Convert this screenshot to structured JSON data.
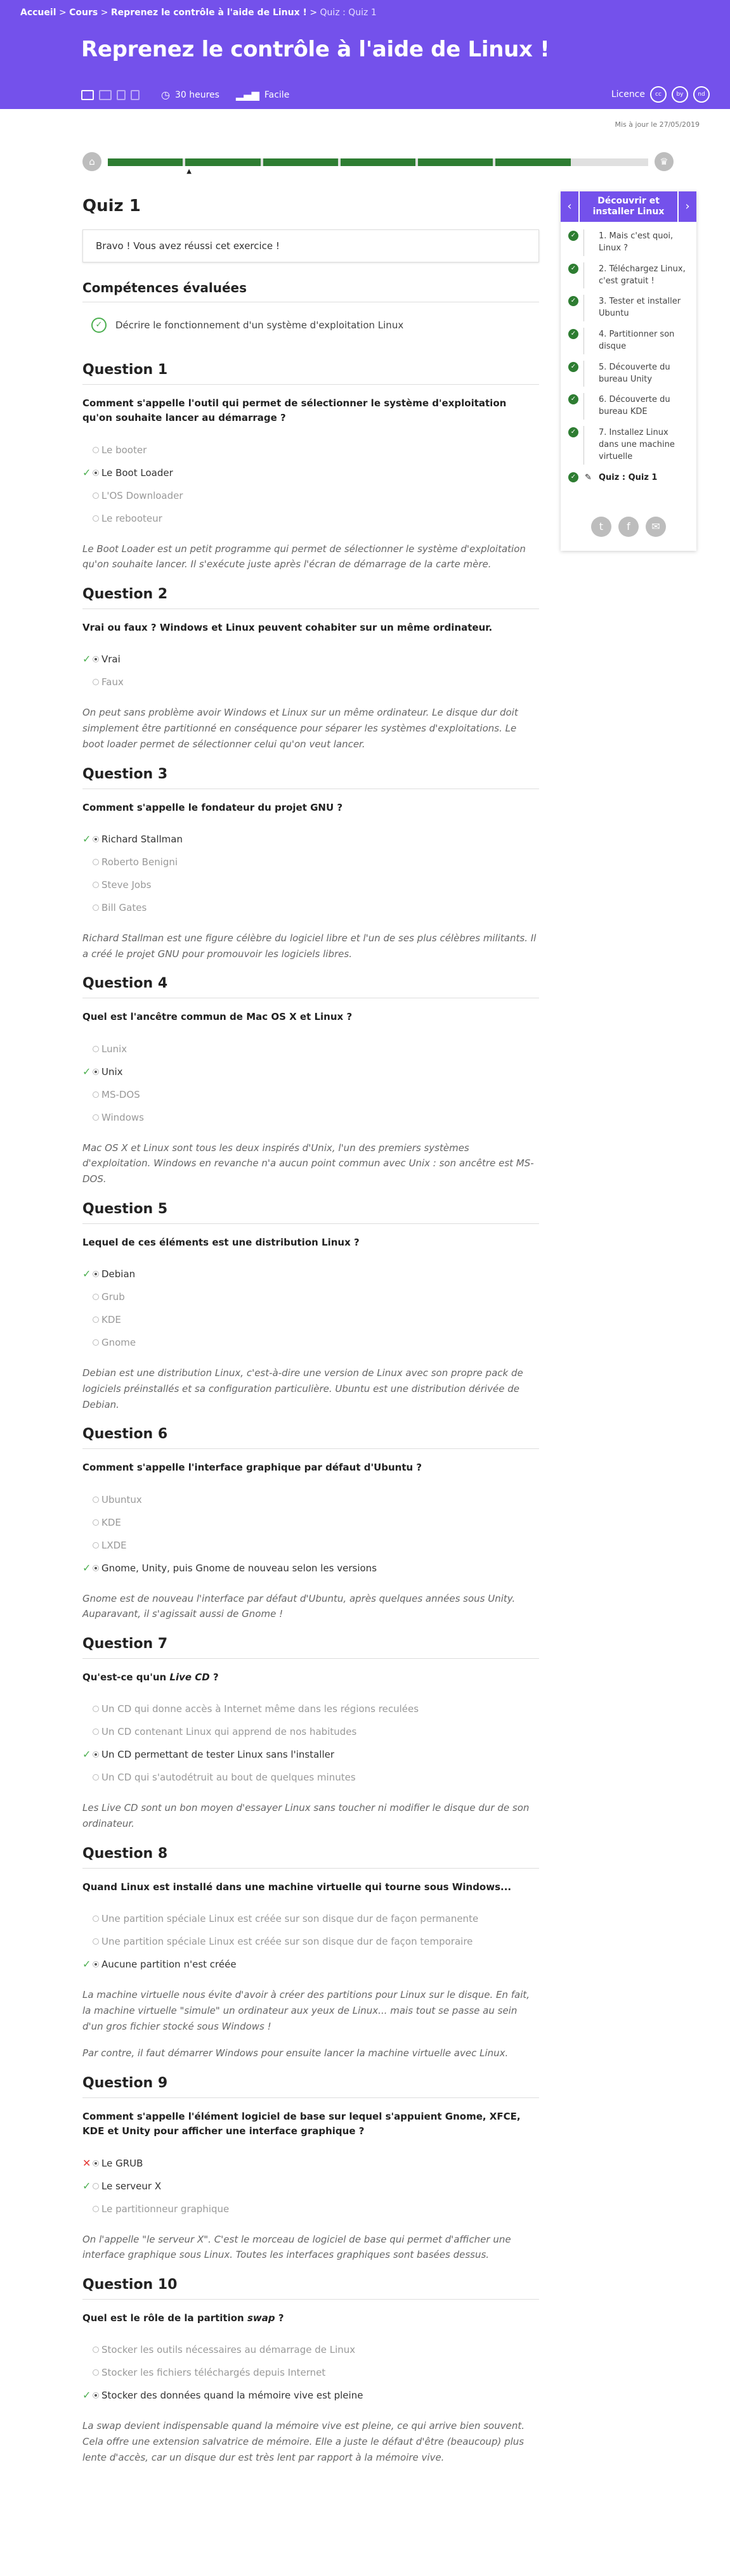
{
  "breadcrumb": {
    "home": "Accueil",
    "sep1": " > ",
    "courses": "Cours",
    "sep2": " > ",
    "course": "Reprenez le contrôle à l'aide de Linux !",
    "sep3": " > ",
    "current": "Quiz : Quiz 1"
  },
  "header": {
    "title": "Reprenez le contrôle à l'aide de Linux !",
    "duration": "30 heures",
    "difficulty": "Facile",
    "licence_label": "Licence",
    "licence_badges": [
      "cc",
      "by",
      "nd"
    ]
  },
  "updated": "Mis à jour le 27/05/2019",
  "progress": {
    "completed_segments": 6,
    "total_segments": 7
  },
  "quiz": {
    "title": "Quiz 1",
    "result": "Bravo ! Vous avez réussi cet exercice !",
    "skills_heading": "Compétences évaluées",
    "skill": "Décrire le fonctionnement d'un système d'exploitation Linux"
  },
  "questions": [
    {
      "heading": "Question 1",
      "prompt": "Comment s'appelle l'outil qui permet de sélectionner le système d'exploitation qu'on souhaite lancer au démarrage ?",
      "answers": [
        {
          "text": "Le booter",
          "state": "none"
        },
        {
          "text": "Le Boot Loader",
          "state": "correct"
        },
        {
          "text": "L'OS Downloader",
          "state": "none"
        },
        {
          "text": "Le rebooteur",
          "state": "none"
        }
      ],
      "explanation": "Le Boot Loader est un petit programme qui permet de sélectionner le système d'exploitation qu'on souhaite lancer. Il s'exécute juste après l'écran de démarrage de la carte mère."
    },
    {
      "heading": "Question 2",
      "prompt": "Vrai ou faux ? Windows et Linux peuvent cohabiter sur un même ordinateur.",
      "answers": [
        {
          "text": "Vrai",
          "state": "correct"
        },
        {
          "text": "Faux",
          "state": "none"
        }
      ],
      "explanation": "On peut sans problème avoir Windows et Linux sur un même ordinateur. Le disque dur doit simplement être partitionné en conséquence pour séparer les systèmes d'exploitations. Le boot loader permet de sélectionner celui qu'on veut lancer."
    },
    {
      "heading": "Question 3",
      "prompt": "Comment s'appelle le fondateur du projet GNU ?",
      "answers": [
        {
          "text": "Richard Stallman",
          "state": "correct"
        },
        {
          "text": "Roberto Benigni",
          "state": "none"
        },
        {
          "text": "Steve Jobs",
          "state": "none"
        },
        {
          "text": "Bill Gates",
          "state": "none"
        }
      ],
      "explanation": "Richard Stallman est une figure célèbre du logiciel libre et l'un de ses plus célèbres militants. Il a créé le projet GNU pour promouvoir les logiciels libres."
    },
    {
      "heading": "Question 4",
      "prompt": "Quel est l'ancêtre commun de Mac OS X et Linux ?",
      "answers": [
        {
          "text": "Lunix",
          "state": "none"
        },
        {
          "text": "Unix",
          "state": "correct"
        },
        {
          "text": "MS-DOS",
          "state": "none"
        },
        {
          "text": "Windows",
          "state": "none"
        }
      ],
      "explanation": "Mac OS X et Linux sont tous les deux inspirés d'Unix, l'un des premiers systèmes d'exploitation. Windows en revanche n'a aucun point commun avec Unix : son ancêtre est MS-DOS."
    },
    {
      "heading": "Question 5",
      "prompt": "Lequel de ces éléments est une distribution Linux ?",
      "answers": [
        {
          "text": "Debian",
          "state": "correct"
        },
        {
          "text": "Grub",
          "state": "none"
        },
        {
          "text": "KDE",
          "state": "none"
        },
        {
          "text": "Gnome",
          "state": "none"
        }
      ],
      "explanation": "Debian est une distribution Linux, c'est-à-dire une version de Linux avec son propre pack de logiciels préinstallés et sa configuration particulière. Ubuntu est une distribution dérivée de Debian."
    },
    {
      "heading": "Question 6",
      "prompt": "Comment s'appelle l'interface graphique par défaut d'Ubuntu ?",
      "answers": [
        {
          "text": "Ubuntux",
          "state": "none"
        },
        {
          "text": "KDE",
          "state": "none"
        },
        {
          "text": "LXDE",
          "state": "none"
        },
        {
          "text": "Gnome, Unity, puis Gnome de nouveau selon les versions",
          "state": "correct"
        }
      ],
      "explanation": "Gnome est de nouveau l'interface par défaut d'Ubuntu, après quelques années sous Unity. Auparavant, il s'agissait aussi de Gnome !"
    },
    {
      "heading": "Question 7",
      "prompt_pre": "Qu'est-ce qu'un ",
      "prompt_em": "Live CD",
      "prompt_post": " ?",
      "answers": [
        {
          "text": "Un CD qui donne accès à Internet même dans les régions reculées",
          "state": "none"
        },
        {
          "text": "Un CD contenant Linux qui apprend de nos habitudes",
          "state": "none"
        },
        {
          "text": "Un CD permettant de tester Linux sans l'installer",
          "state": "correct"
        },
        {
          "text": "Un CD qui s'autodétruit au bout de quelques minutes",
          "state": "none"
        }
      ],
      "explanation": "Les Live CD sont un bon moyen d'essayer Linux sans toucher ni modifier le disque dur de son ordinateur."
    },
    {
      "heading": "Question 8",
      "prompt": "Quand Linux est installé dans une machine virtuelle qui tourne sous Windows...",
      "answers": [
        {
          "text": "Une partition spéciale Linux est créée sur son disque dur de façon permanente",
          "state": "none"
        },
        {
          "text": "Une partition spéciale Linux est créée sur son disque dur de façon temporaire",
          "state": "none"
        },
        {
          "text": "Aucune partition n'est créée",
          "state": "correct"
        }
      ],
      "explanation": "La machine virtuelle nous évite d'avoir à créer des partitions pour Linux sur le disque. En fait, la machine virtuelle \"simule\" un ordinateur aux yeux de Linux... mais tout se passe au sein d'un gros fichier stocké sous Windows !",
      "explanation2": "Par contre, il faut démarrer Windows pour ensuite lancer la machine virtuelle avec Linux."
    },
    {
      "heading": "Question 9",
      "prompt": "Comment s'appelle l'élément logiciel de base sur lequel s'appuient Gnome, XFCE, KDE et Unity pour afficher une interface graphique ?",
      "answers": [
        {
          "text": "Le GRUB",
          "state": "wrong"
        },
        {
          "text": "Le serveur X",
          "state": "correct_unselected"
        },
        {
          "text": "Le partitionneur graphique",
          "state": "none"
        }
      ],
      "explanation": "On l'appelle \"le serveur X\". C'est le morceau de logiciel de base qui permet d'afficher une interface graphique sous Linux. Toutes les interfaces graphiques sont basées dessus."
    },
    {
      "heading": "Question 10",
      "prompt_pre": "Quel est le rôle de la partition ",
      "prompt_em": "swap",
      "prompt_post": " ?",
      "answers": [
        {
          "text": "Stocker les outils nécessaires au démarrage de Linux",
          "state": "none"
        },
        {
          "text": "Stocker les fichiers téléchargés depuis Internet",
          "state": "none"
        },
        {
          "text": "Stocker des données quand la mémoire vive est pleine",
          "state": "correct"
        }
      ],
      "explanation": "La swap devient indispensable quand la mémoire vive est pleine, ce qui arrive bien souvent. Cela offre une extension salvatrice de mémoire. Elle a juste le défaut d'être (beaucoup) plus lente d'accès, car un disque dur est très lent par rapport à la mémoire vive."
    }
  ],
  "sidebar": {
    "title": "Découvrir et installer Linux",
    "items": [
      "1. Mais c'est quoi, Linux ?",
      "2. Téléchargez Linux, c'est gratuit !",
      "3. Tester et installer Ubuntu",
      "4. Partitionner son disque",
      "5. Découverte du bureau Unity",
      "6. Découverte du bureau KDE",
      "7. Installez Linux dans une machine virtuelle"
    ],
    "quiz_item": "Quiz : Quiz 1",
    "social": [
      "twitter-icon",
      "facebook-icon",
      "mail-icon"
    ]
  },
  "colors": {
    "brand": "#7451eb",
    "progress": "#2e7d32",
    "correct": "#4caf50",
    "wrong": "#e53935"
  }
}
